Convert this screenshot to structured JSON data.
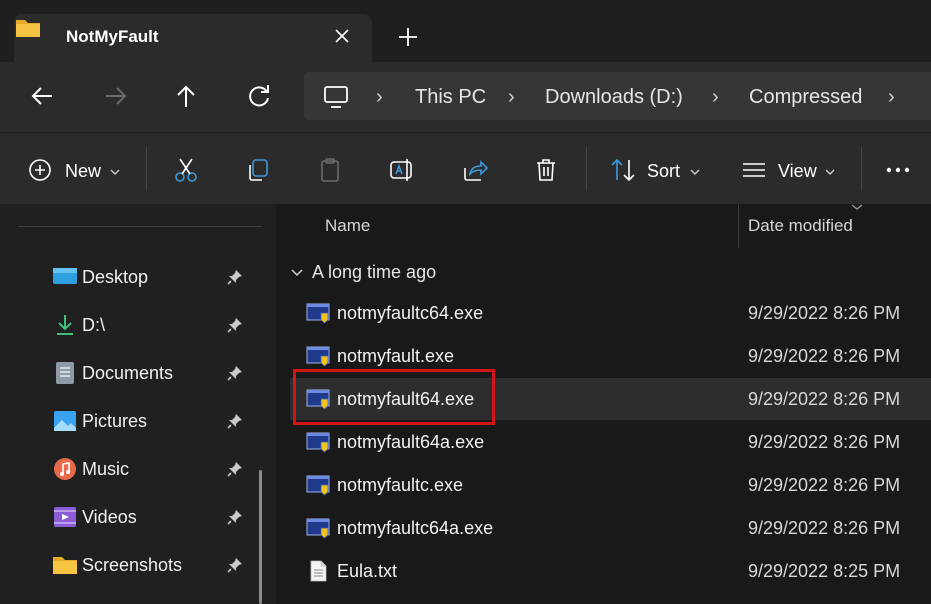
{
  "window": {
    "tab_title": "NotMyFault"
  },
  "address": {
    "crumbs": [
      "This PC",
      "Downloads (D:)",
      "Compressed"
    ]
  },
  "toolbar": {
    "new_label": "New",
    "sort_label": "Sort",
    "view_label": "View"
  },
  "sidebar": {
    "items": [
      {
        "label": "Desktop",
        "icon": "desktop-icon"
      },
      {
        "label": "D:\\",
        "icon": "download-icon"
      },
      {
        "label": "Documents",
        "icon": "documents-icon"
      },
      {
        "label": "Pictures",
        "icon": "pictures-icon"
      },
      {
        "label": "Music",
        "icon": "music-icon"
      },
      {
        "label": "Videos",
        "icon": "videos-icon"
      },
      {
        "label": "Screenshots",
        "icon": "folder-icon"
      }
    ]
  },
  "columns": {
    "name": "Name",
    "date": "Date modified"
  },
  "group": {
    "title": "A long time ago"
  },
  "files": [
    {
      "name": "notmyfaultc64.exe",
      "date": "9/29/2022 8:26 PM",
      "type": "exe"
    },
    {
      "name": "notmyfault.exe",
      "date": "9/29/2022 8:26 PM",
      "type": "exe"
    },
    {
      "name": "notmyfault64.exe",
      "date": "9/29/2022 8:26 PM",
      "type": "exe"
    },
    {
      "name": "notmyfault64a.exe",
      "date": "9/29/2022 8:26 PM",
      "type": "exe"
    },
    {
      "name": "notmyfaultc.exe",
      "date": "9/29/2022 8:26 PM",
      "type": "exe"
    },
    {
      "name": "notmyfaultc64a.exe",
      "date": "9/29/2022 8:26 PM",
      "type": "exe"
    },
    {
      "name": "Eula.txt",
      "date": "9/29/2022 8:25 PM",
      "type": "txt"
    }
  ],
  "colors": {
    "highlight": "#d11616",
    "folder": "#f6c343",
    "accent": "#3a9bdc"
  }
}
